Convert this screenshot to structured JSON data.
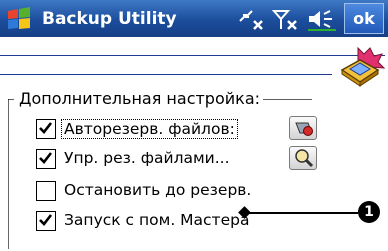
{
  "title_bar": {
    "app_title": "Backup Utility",
    "ok_label": "ok",
    "icons": [
      "windows-start-icon",
      "connectivity-icon",
      "signal-icon",
      "volume-icon"
    ]
  },
  "header_icon": "backup-utility-icon",
  "settings_group": {
    "legend": "Дополнительная настройка:",
    "options": [
      {
        "label": "Авторезерв. файлов:",
        "checked": true,
        "side_icon": "auto-backup-icon"
      },
      {
        "label": "Упр. рез. файлами...",
        "checked": true,
        "side_icon": "search-files-icon"
      },
      {
        "label": "Остановить до резерв.",
        "checked": false
      },
      {
        "label": "Запуск с пом. Мастера",
        "checked": true
      }
    ]
  },
  "callout": {
    "number": "1"
  },
  "colors": {
    "title_bar": "#1b4d9c",
    "rule": "#1f3a93",
    "accent_green": "#2bb02b"
  }
}
